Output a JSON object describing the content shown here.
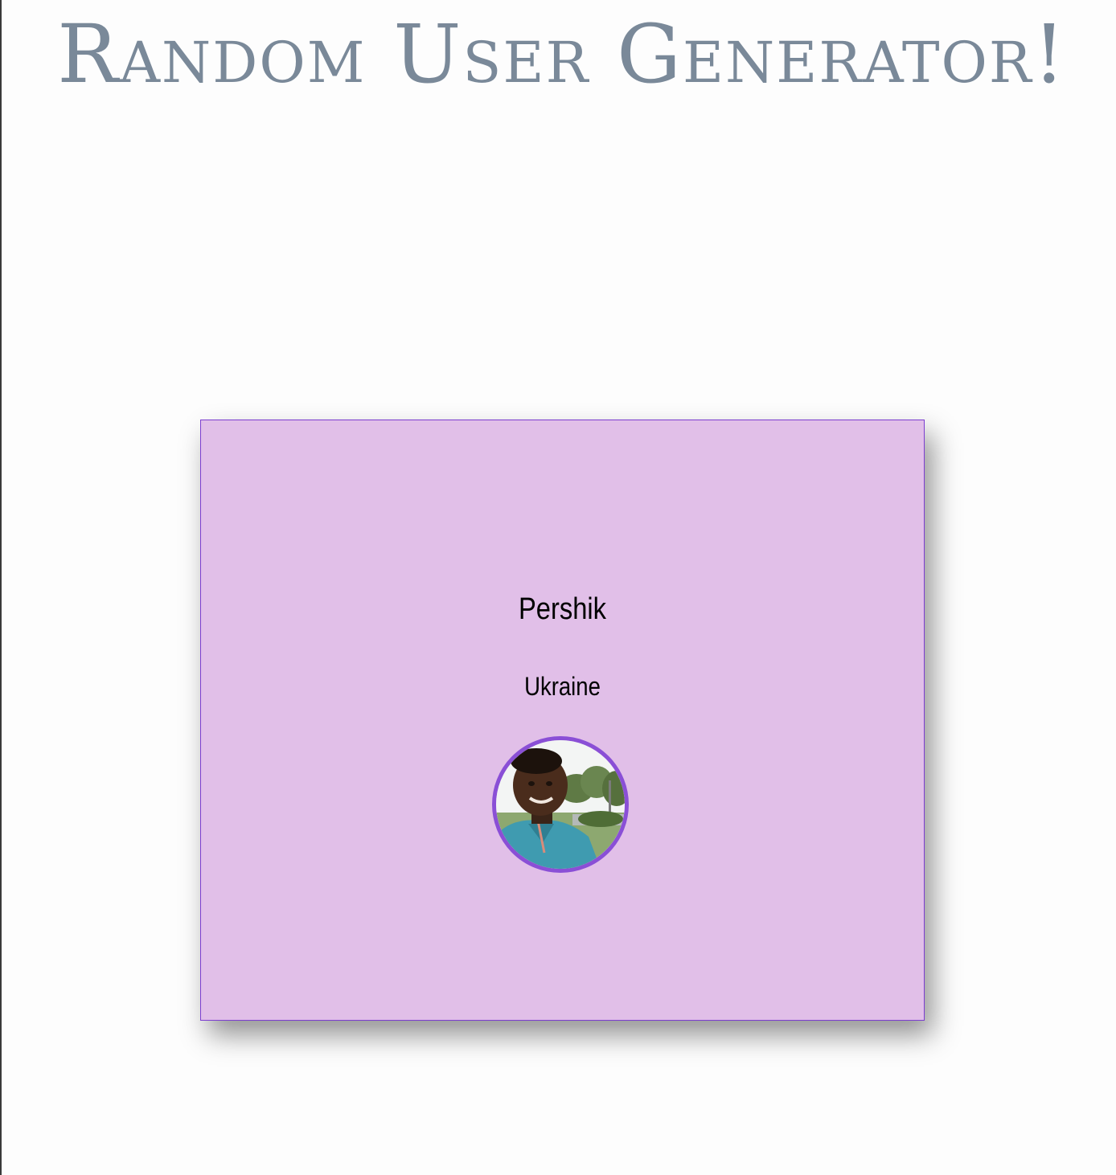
{
  "page": {
    "title": "Random User Generator!",
    "title_color": "#7a8999",
    "background_color": "#fdfdfd"
  },
  "card": {
    "name": "Pershik",
    "country": "Ukraine",
    "background_color": "#e1bfe8",
    "border_color": "#7c3ed0",
    "avatar_ring_color": "#8a4fd6",
    "avatar_icon": "user-photo"
  }
}
